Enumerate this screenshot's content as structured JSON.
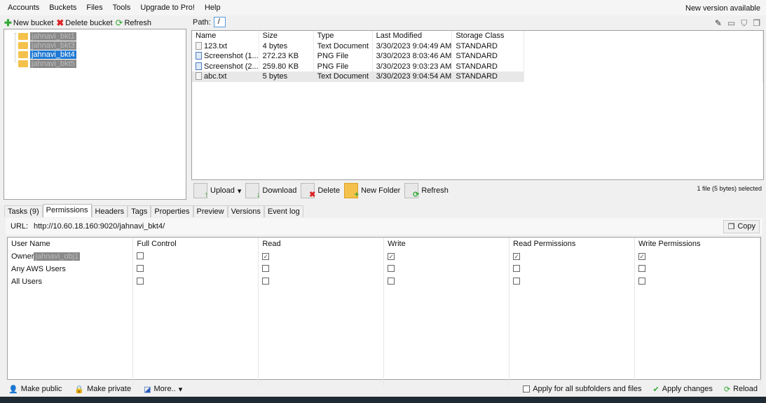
{
  "menu": [
    "Accounts",
    "Buckets",
    "Files",
    "Tools",
    "Upgrade to Pro!",
    "Help"
  ],
  "new_version": "New version available",
  "bucket_toolbar": {
    "new": "New bucket",
    "delete": "Delete bucket",
    "refresh": "Refresh"
  },
  "buckets": [
    {
      "name": "jahnavi_bkt1",
      "redacted": true
    },
    {
      "name": "jahnavi_bkt3",
      "redacted": true
    },
    {
      "name": "jahnavi_bkt4",
      "selected": true
    },
    {
      "name": "jahnavi_bkt5",
      "redacted": true
    }
  ],
  "path": {
    "label": "Path:",
    "value": "/"
  },
  "files": {
    "columns": [
      "Name",
      "Size",
      "Type",
      "Last Modified",
      "Storage Class"
    ],
    "rows": [
      {
        "name": "123.txt",
        "size": "4 bytes",
        "type": "Text Document",
        "modified": "3/30/2023 9:04:49 AM",
        "class": "STANDARD",
        "icon": "text-file-icon"
      },
      {
        "name": "Screenshot (1...",
        "size": "272.23 KB",
        "type": "PNG File",
        "modified": "3/30/2023 8:03:46 AM",
        "class": "STANDARD",
        "icon": "png-file-icon"
      },
      {
        "name": "Screenshot (2...",
        "size": "259.80 KB",
        "type": "PNG File",
        "modified": "3/30/2023 9:03:23 AM",
        "class": "STANDARD",
        "icon": "png-file-icon"
      },
      {
        "name": "abc.txt",
        "size": "5 bytes",
        "type": "Text Document",
        "modified": "3/30/2023 9:04:54 AM",
        "class": "STANDARD",
        "icon": "text-file-icon",
        "selected": true
      }
    ]
  },
  "file_actions": {
    "upload": "Upload",
    "download": "Download",
    "delete": "Delete",
    "new_folder": "New Folder",
    "refresh": "Refresh"
  },
  "status": "1 file (5 bytes) selected",
  "tabs": [
    "Tasks (9)",
    "Permissions",
    "Headers",
    "Tags",
    "Properties",
    "Preview",
    "Versions",
    "Event log"
  ],
  "active_tab": "Permissions",
  "url": {
    "label": "URL:",
    "value": "http://10.60.18.160:9020/jahnavi_bkt4/",
    "copy": "Copy"
  },
  "permissions": {
    "columns": [
      "User Name",
      "Full Control",
      "Read",
      "Write",
      "Read Permissions",
      "Write Permissions"
    ],
    "rows": [
      {
        "user": "Owner",
        "owner_name": "jahnavi_obj1",
        "checks": [
          false,
          true,
          true,
          true,
          true
        ]
      },
      {
        "user": "Any AWS Users",
        "checks": [
          false,
          false,
          false,
          false,
          false
        ]
      },
      {
        "user": "All Users",
        "checks": [
          false,
          false,
          false,
          false,
          false
        ]
      }
    ]
  },
  "bottom": {
    "make_public": "Make public",
    "make_private": "Make private",
    "more": "More..",
    "apply_all": "Apply for all subfolders and files",
    "apply_changes": "Apply changes",
    "reload": "Reload"
  }
}
